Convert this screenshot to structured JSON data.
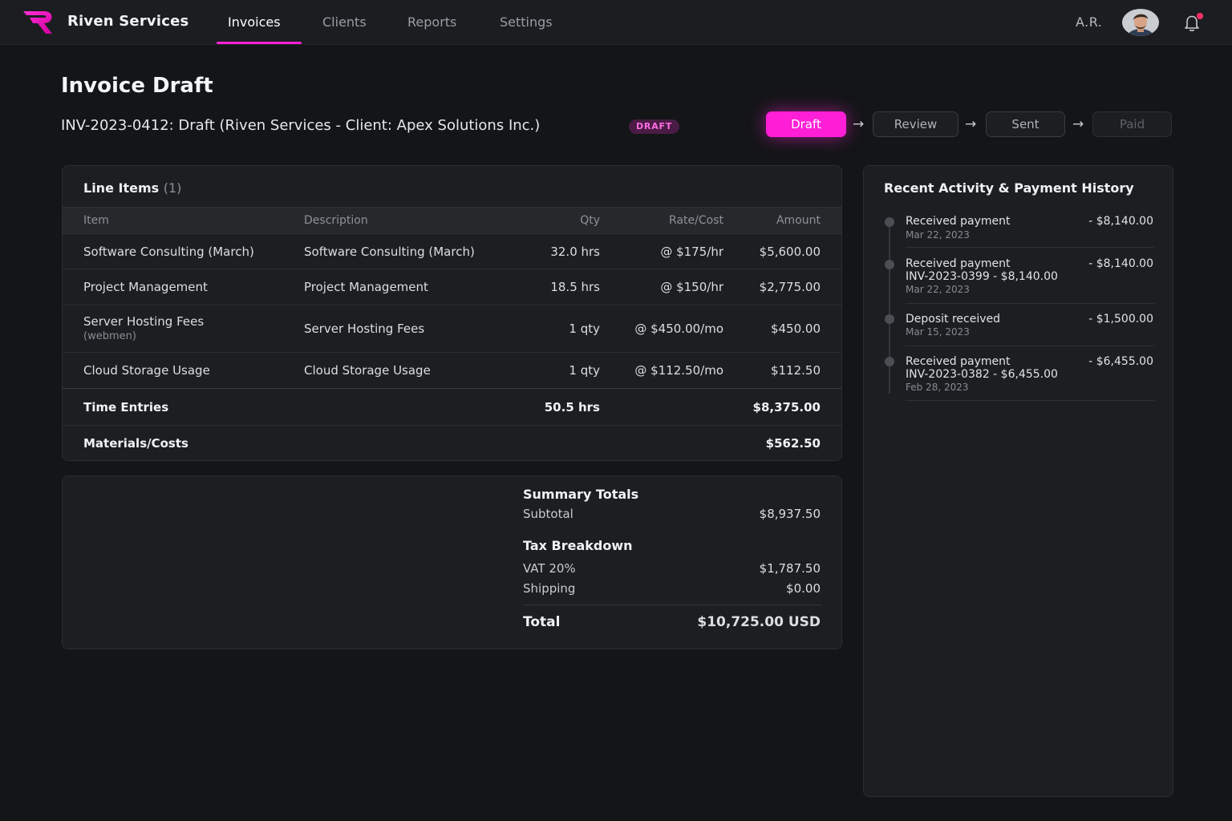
{
  "nav": {
    "brand": "Riven Services",
    "links": [
      "Invoices",
      "Clients",
      "Reports",
      "Settings"
    ],
    "active_link": "Invoices",
    "user_initials": "A.R.",
    "accent_color": "#ff1fd6"
  },
  "header": {
    "title": "Invoice Draft",
    "subtitle": "INV-2023-0412: Draft (Riven Services - Client: Apex Solutions Inc.)",
    "badge": "DRAFT"
  },
  "stepper": {
    "steps": [
      "Draft",
      "Review",
      "Sent",
      "Paid"
    ],
    "active": "Draft"
  },
  "line_items": {
    "title": "Line Items",
    "count": "(1)",
    "columns": [
      "Item",
      "Description",
      "Qty",
      "Rate/Cost",
      "Amount"
    ],
    "rows": [
      {
        "item": "Software Consulting (March)",
        "item_sub": "",
        "description": "Software Consulting (March)",
        "qty": "32.0 hrs",
        "rate": "@ $175/hr",
        "amount": "$5,600.00"
      },
      {
        "item": "Project Management",
        "item_sub": "",
        "description": "Project Management",
        "qty": "18.5 hrs",
        "rate": "@ $150/hr",
        "amount": "$2,775.00"
      },
      {
        "item": "Server Hosting Fees",
        "item_sub": "(webmen)",
        "description": "Server Hosting Fees",
        "qty": "1 qty",
        "rate": "@ $450.00/mo",
        "amount": "$450.00"
      },
      {
        "item": "Cloud Storage Usage",
        "item_sub": "",
        "description": "Cloud Storage Usage",
        "qty": "1 qty",
        "rate": "@ $112.50/mo",
        "amount": "$112.50"
      }
    ],
    "time_entries": {
      "label": "Time Entries",
      "qty": "50.5 hrs",
      "amount": "$8,375.00"
    },
    "materials": {
      "label": "Materials/Costs",
      "amount": "$562.50"
    }
  },
  "summary": {
    "title": "Summary Totals",
    "subtotal_label": "Subtotal",
    "subtotal": "$8,937.50",
    "tax_title": "Tax Breakdown",
    "vat_label": "VAT 20%",
    "vat": "$1,787.50",
    "shipping_label": "Shipping",
    "shipping": "$0.00",
    "total_label": "Total",
    "total": "$10,725.00 USD"
  },
  "activity": {
    "title": "Recent Activity & Payment History",
    "items": [
      {
        "text": "Received payment",
        "ref": "",
        "date": "Mar 22, 2023",
        "amount": "- $8,140.00"
      },
      {
        "text": "Received payment",
        "ref": "INV-2023-0399 - $8,140.00",
        "date": "Mar 22, 2023",
        "amount": "- $8,140.00"
      },
      {
        "text": "Deposit received",
        "ref": "",
        "date": "Mar 15, 2023",
        "amount": "- $1,500.00"
      },
      {
        "text": "Received payment",
        "ref": "INV-2023-0382 - $6,455.00",
        "date": "Feb 28, 2023",
        "amount": "- $6,455.00"
      }
    ]
  }
}
